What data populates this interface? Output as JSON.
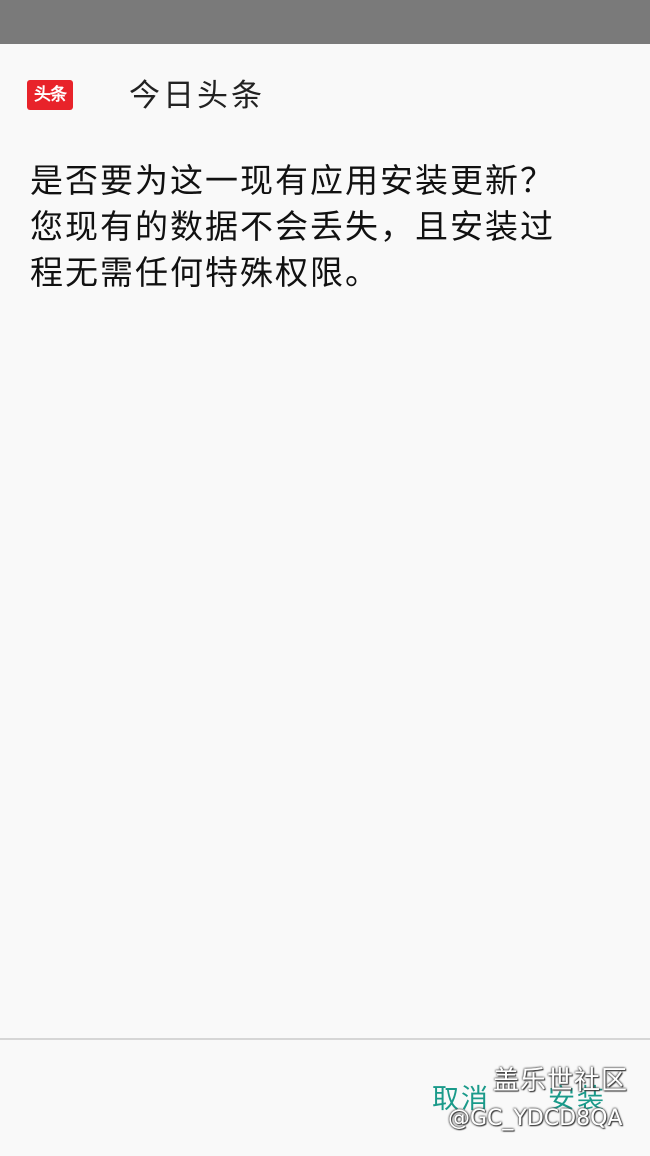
{
  "app": {
    "icon_label": "头条",
    "name": "今日头条"
  },
  "dialog": {
    "message_lines": [
      "是否要为这一现有应用安装更新？",
      "您现有的数据不会丢失，且安装过",
      "程无需任何特殊权限。"
    ]
  },
  "buttons": {
    "cancel_label": "取消",
    "install_label": "安装"
  },
  "watermark": {
    "title": "盖乐世社区",
    "handle": "@GC_YDCD8QA"
  },
  "colors": {
    "status_bar": "#7a7a7a",
    "background": "#f9f9f9",
    "app_icon": "#e8232a",
    "button_text": "#1a9a8a",
    "divider": "#d6d6d6"
  }
}
